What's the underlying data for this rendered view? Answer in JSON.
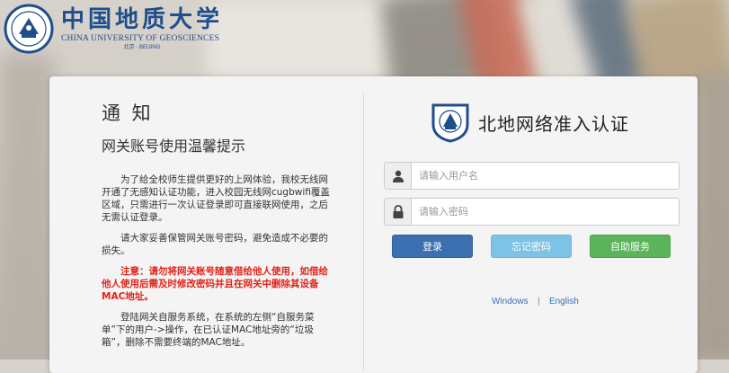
{
  "brand": {
    "name_cn": "中国地质大学",
    "name_en": "CHINA UNIVERSITY OF GEOSCIENCES",
    "location": "北京 · BEIJING"
  },
  "notice": {
    "title": "通 知",
    "subtitle": "网关账号使用温馨提示",
    "paragraphs": [
      "为了给全校师生提供更好的上网体验，我校无线网开通了无感知认证功能，进入校园无线网cugbwifi覆盖区域，只需进行一次认证登录即可直接联网使用，之后无需认证登录。",
      "请大家妥善保管网关账号密码，避免造成不必要的损失。",
      "注意：请勿将网关账号随意借给他人使用，如借给他人使用后需及时修改密码并且在网关中删除其设备MAC地址。",
      "登陆网关自服务系统，在系统的左侧“自服务菜单”下的用户->操作，在已认证MAC地址旁的“垃圾箱”，删除不需要终端的MAC地址。"
    ]
  },
  "login": {
    "title": "北地网络准入认证",
    "username_placeholder": "请输入用户名",
    "password_placeholder": "请输入密码",
    "username_value": "",
    "password_value": "",
    "buttons": {
      "login": "登录",
      "forgot": "忘记密码",
      "self_service": "自助服务"
    },
    "languages": [
      "Windows",
      "English"
    ]
  },
  "colors": {
    "brand_blue": "#1f4e8c",
    "login_button": "#3c6fb0",
    "forgot_button": "#7cc3e6",
    "self_service_button": "#5bb35a",
    "warning_text": "#e2231a"
  },
  "icons": {
    "username": "user-icon",
    "password": "lock-icon"
  }
}
